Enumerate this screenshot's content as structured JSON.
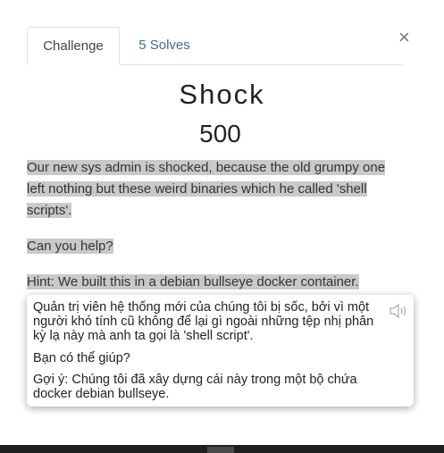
{
  "tabs": [
    {
      "label": "Challenge",
      "active": true
    },
    {
      "label": "5 Solves",
      "active": false
    }
  ],
  "close_label": "×",
  "challenge": {
    "name": "Shock",
    "points": "500",
    "description": [
      "Our new sys admin is shocked, because the old grumpy one left nothing but these weird binaries which he called 'shell scripts'.",
      "Can you help?",
      "Hint: We built this in a debian bullseye docker container."
    ]
  },
  "translation_popup": {
    "lines": [
      "Quản trị viên hệ thống mới của chúng tôi bị sốc, bởi vì một người khó tính cũ không để lại gì ngoài những tệp nhị phân kỳ lạ này mà anh ta gọi là 'shell script'.",
      "Bạn có thể giúp?",
      "Gợi ý: Chúng tôi đã xây dựng cái này trong một bộ chứa docker debian bullseye."
    ],
    "icon": "speaker-icon"
  },
  "colors": {
    "highlight": "#c9c9c9",
    "link": "#3a6ea5"
  }
}
